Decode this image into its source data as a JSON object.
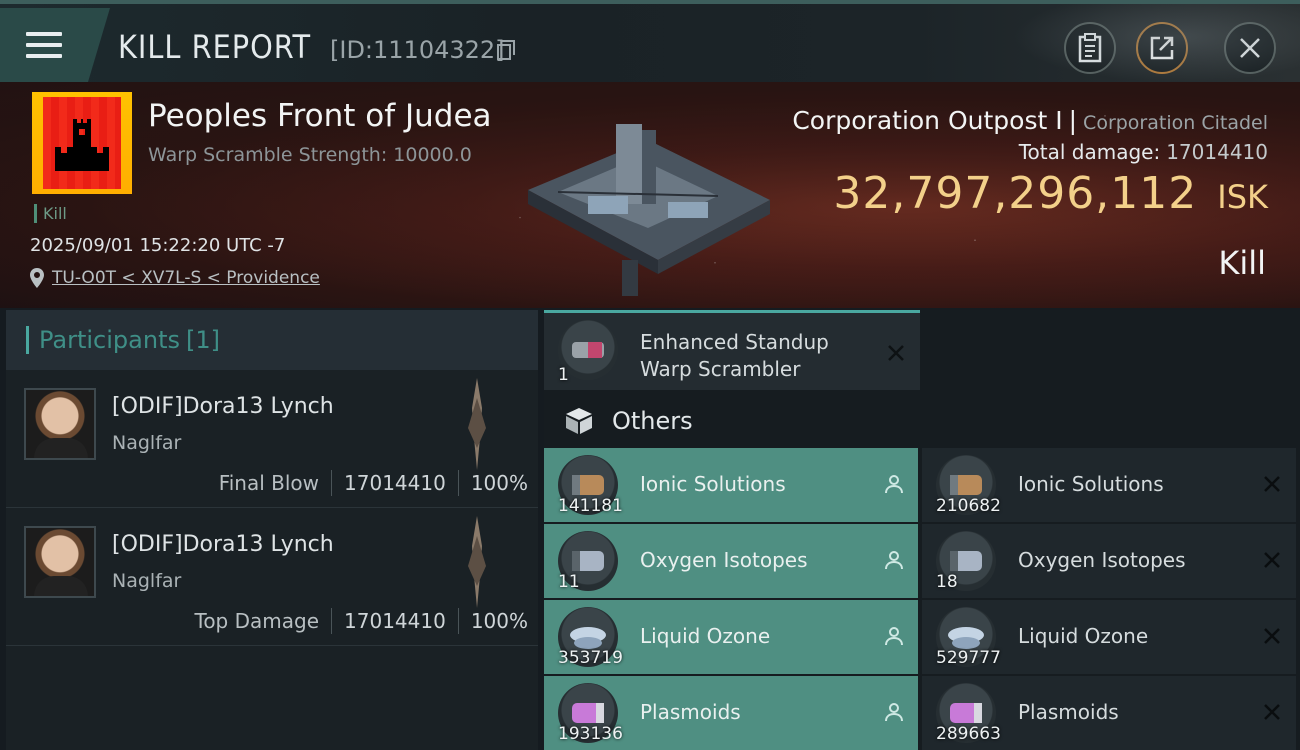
{
  "header": {
    "title": "KILL REPORT",
    "report_id": "[ID:11104322]"
  },
  "victim": {
    "corp_name": "Peoples Front of Judea",
    "warp_strength": "Warp Scramble Strength: 10000.0",
    "kill_tag": "Kill",
    "datetime": "2025/09/01 15:22:20 UTC -7",
    "location": "TU-O0T < XV7L-S < Providence"
  },
  "target": {
    "name": "Corporation Outpost I",
    "separator": "|",
    "class": "Corporation Citadel",
    "total_damage_label": "Total damage:",
    "total_damage_value": "17014410",
    "isk_value": "32,797,296,112",
    "isk_unit": "ISK",
    "result": "Kill"
  },
  "participants": {
    "label": "Participants",
    "count": "[1]",
    "rows": [
      {
        "name": "[ODIF]Dora13 Lynch",
        "ship": "Naglfar",
        "role": "Final Blow",
        "damage": "17014410",
        "percent": "100%"
      },
      {
        "name": "[ODIF]Dora13 Lynch",
        "ship": "Naglfar",
        "role": "Top Damage",
        "damage": "17014410",
        "percent": "100%"
      }
    ]
  },
  "fitted": {
    "qty": "1",
    "name_line1": "Enhanced Standup",
    "name_line2": "Warp Scrambler"
  },
  "others_label": "Others",
  "items": [
    {
      "name": "Ionic Solutions",
      "dropped_qty": "141181",
      "destroyed_qty": "210682"
    },
    {
      "name": "Oxygen Isotopes",
      "dropped_qty": "11",
      "destroyed_qty": "18"
    },
    {
      "name": "Liquid Ozone",
      "dropped_qty": "353719",
      "destroyed_qty": "529777"
    },
    {
      "name": "Plasmoids",
      "dropped_qty": "193136",
      "destroyed_qty": "289663"
    }
  ],
  "colors": {
    "accent_teal": "#4aa8a0",
    "dropped_bg": "#4f8f82",
    "isk_gold": "#f3d08a"
  }
}
